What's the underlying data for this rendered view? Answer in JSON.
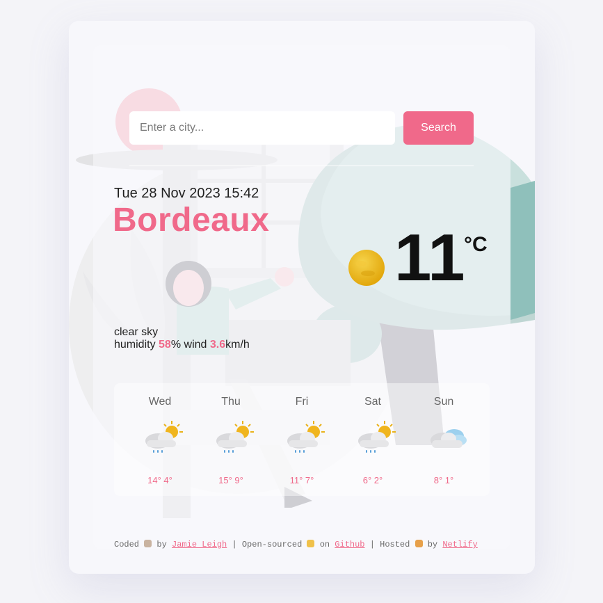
{
  "search": {
    "placeholder": "Enter a city...",
    "button_label": "Search"
  },
  "current": {
    "datetime": "Tue 28 Nov 2023 15:42",
    "city": "Bordeaux",
    "temperature": "11",
    "unit": "°C",
    "description": "clear sky",
    "humidity_label": "humidity",
    "humidity_value": "58",
    "humidity_unit": "%",
    "wind_label": "wind",
    "wind_value": "3.6",
    "wind_unit": "km/h",
    "icon": "sun-icon"
  },
  "forecast": [
    {
      "day": "Wed",
      "temps": "14° 4°",
      "icon": "partly-cloudy-rain-icon"
    },
    {
      "day": "Thu",
      "temps": "15° 9°",
      "icon": "partly-cloudy-rain-icon"
    },
    {
      "day": "Fri",
      "temps": "11° 7°",
      "icon": "partly-cloudy-rain-icon"
    },
    {
      "day": "Sat",
      "temps": "6° 2°",
      "icon": "partly-cloudy-rain-icon"
    },
    {
      "day": "Sun",
      "temps": "8° 1°",
      "icon": "cloudy-icon"
    }
  ],
  "footer": {
    "coded": "Coded",
    "by1": "by",
    "author": "Jamie Leigh",
    "open_sourced": "| Open-sourced",
    "on": "on",
    "github": "Github",
    "hosted": "| Hosted",
    "by2": "by",
    "netlify": "Netlify"
  },
  "colors": {
    "accent": "#f0698a",
    "background": "#f7f7fb",
    "temperature": "#111111"
  }
}
